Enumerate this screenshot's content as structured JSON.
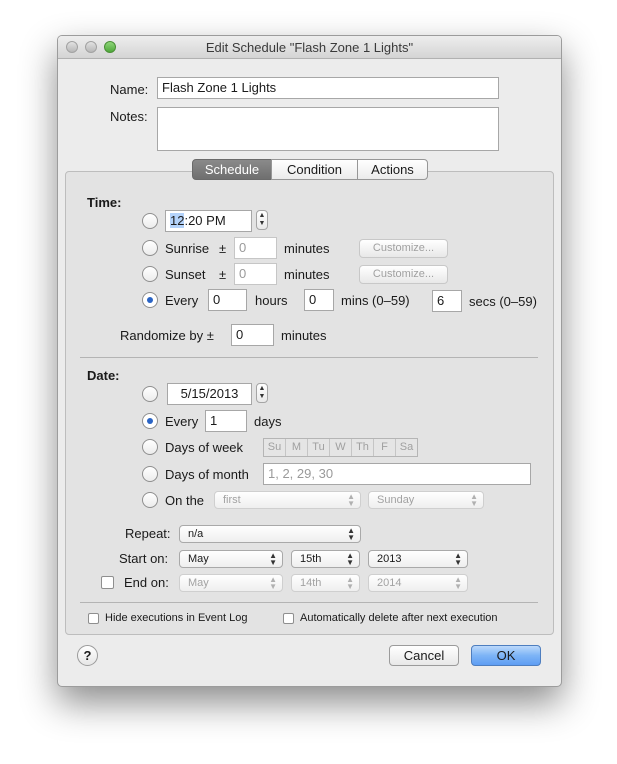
{
  "window": {
    "title": "Edit Schedule \"Flash Zone 1 Lights\""
  },
  "form": {
    "name_label": "Name:",
    "name_value": "Flash Zone 1 Lights",
    "notes_label": "Notes:",
    "notes_value": ""
  },
  "tabs": [
    "Schedule",
    "Condition",
    "Actions"
  ],
  "time": {
    "heading": "Time:",
    "clock_hour": "12",
    "clock_rest": ":20 PM",
    "sunrise_label": "Sunrise",
    "sunset_label": "Sunset",
    "plusminus": "±",
    "sunrise_value": "0",
    "sunset_value": "0",
    "minutes_label": "minutes",
    "customize_label": "Customize...",
    "every_label": "Every",
    "every_hours": "0",
    "hours_label": "hours",
    "every_mins": "0",
    "mins_label": "mins (0–59)",
    "every_secs": "6",
    "secs_label": "secs (0–59)",
    "randomize_label": "Randomize by ±",
    "randomize_value": "0",
    "randomize_unit": "minutes"
  },
  "date": {
    "heading": "Date:",
    "date_value": "5/15/2013",
    "every_label": "Every",
    "every_value": "1",
    "days_label": "days",
    "days_of_week_label": "Days of week",
    "weekdays": [
      "Su",
      "M",
      "Tu",
      "W",
      "Th",
      "F",
      "Sa"
    ],
    "days_of_month_label": "Days of month",
    "days_of_month_placeholder": "1, 2, 29, 30",
    "on_the_label": "On the",
    "on_the_ordinal": "first",
    "on_the_day": "Sunday",
    "repeat_label": "Repeat:",
    "repeat_value": "n/a",
    "start_label": "Start on:",
    "start_month": "May",
    "start_day": "15th",
    "start_year": "2013",
    "end_label": "End on:",
    "end_month": "May",
    "end_day": "14th",
    "end_year": "2014"
  },
  "options": {
    "hide_executions": "Hide executions in Event Log",
    "auto_delete": "Automatically delete after next execution"
  },
  "buttons": {
    "help": "?",
    "cancel": "Cancel",
    "ok": "OK"
  },
  "colors": {
    "accent": "#2a64c5",
    "default_button": "#6aa7f5",
    "selected_tab": "#7a7a7a"
  },
  "selections": {
    "time_mode": "every",
    "date_mode": "every",
    "end_on_checked": false,
    "hide_executions_checked": false,
    "auto_delete_checked": false
  }
}
